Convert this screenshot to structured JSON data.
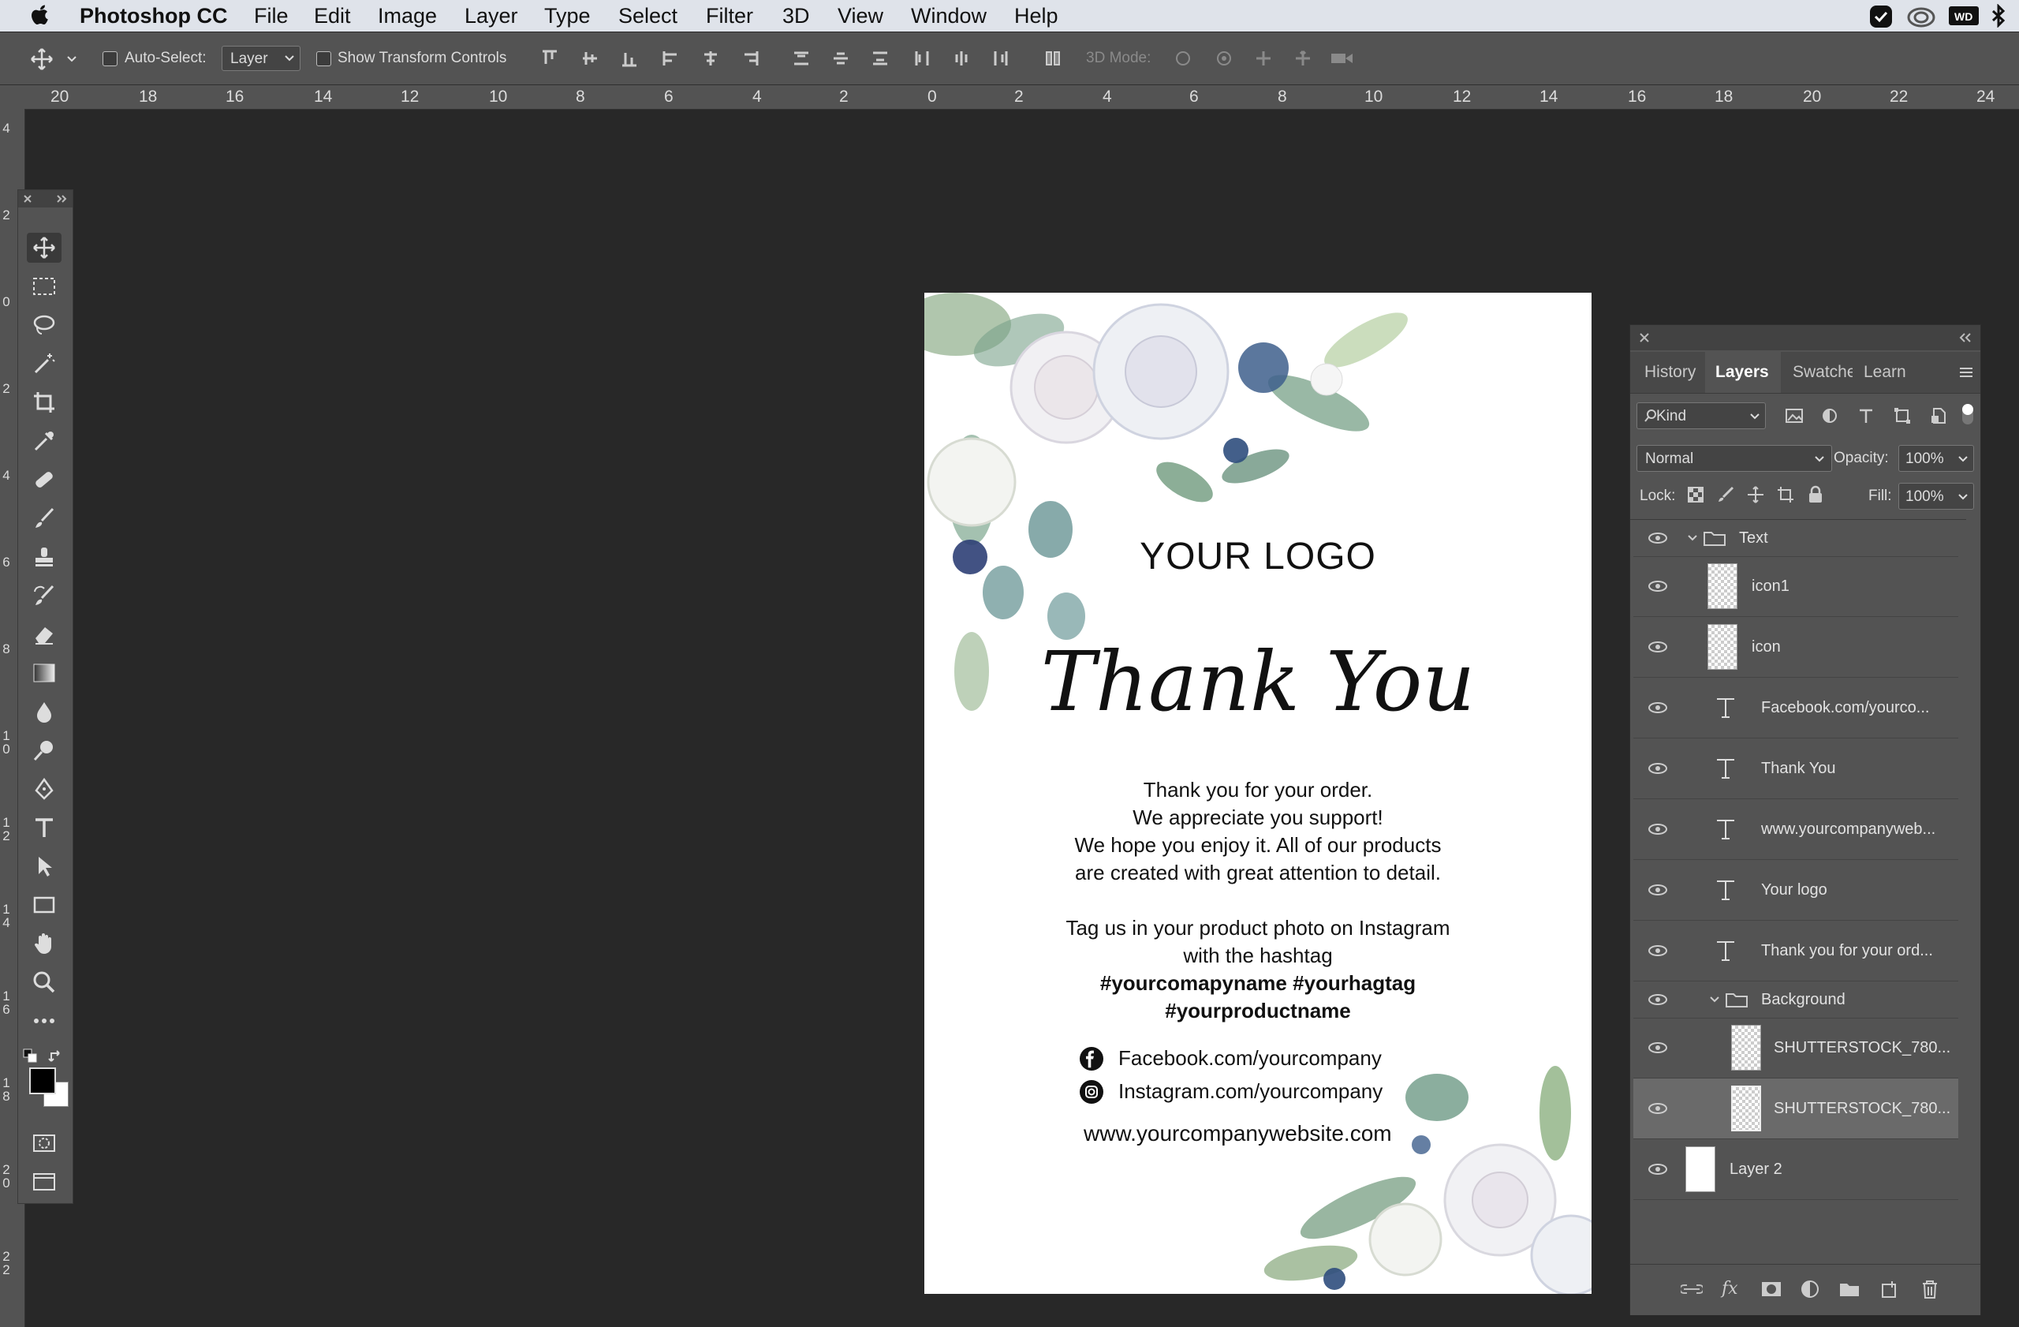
{
  "menubar": {
    "app": "Photoshop CC",
    "items": [
      "File",
      "Edit",
      "Image",
      "Layer",
      "Type",
      "Select",
      "Filter",
      "3D",
      "View",
      "Window",
      "Help"
    ]
  },
  "options": {
    "auto_select_label": "Auto-Select:",
    "auto_select_value": "Layer",
    "transform_label": "Show Transform Controls",
    "mode3d_label": "3D Mode:"
  },
  "ruler": {
    "h": [
      "20",
      "18",
      "16",
      "14",
      "12",
      "10",
      "8",
      "6",
      "4",
      "2",
      "0",
      "2",
      "4",
      "6",
      "8",
      "10",
      "12",
      "14",
      "16",
      "18",
      "20",
      "22",
      "24"
    ],
    "v": [
      "4",
      "2",
      "0",
      "2",
      "4",
      "6",
      "8",
      "1\n0",
      "1\n2",
      "1\n4",
      "1\n6",
      "1\n8",
      "2\n0",
      "2\n2"
    ]
  },
  "document": {
    "logo": "YOUR LOGO",
    "title": "Thank You",
    "body1": "Thank you for your order.",
    "body2": "We appreciate you support!",
    "body3": "We hope you enjoy it. All of our products",
    "body4": "are created with great attention to detail.",
    "tag1": "Tag us in your product photo on Instagram",
    "tag2": "with the hashtag",
    "hash1": "#yourcomapyname #yourhagtag",
    "hash2": "#yourproductname",
    "facebook": "Facebook.com/yourcompany",
    "instagram": "Instagram.com/yourcompany",
    "website": "www.yourcompanywebsite.com"
  },
  "panel": {
    "tabs": [
      "History",
      "Layers",
      "Swatche",
      "Learn"
    ],
    "filter_kind": "Kind",
    "blend_mode": "Normal",
    "opacity_label": "Opacity:",
    "opacity_value": "100%",
    "lock_label": "Lock:",
    "fill_label": "Fill:",
    "fill_value": "100%",
    "layers": [
      {
        "name": "Text",
        "kind": "group"
      },
      {
        "name": "icon1",
        "kind": "pixel"
      },
      {
        "name": "icon",
        "kind": "pixel"
      },
      {
        "name": "Facebook.com/yourco...",
        "kind": "text"
      },
      {
        "name": "Thank You",
        "kind": "text"
      },
      {
        "name": "www.yourcompanyweb...",
        "kind": "text"
      },
      {
        "name": "Your logo",
        "kind": "text"
      },
      {
        "name": "Thank you for your ord...",
        "kind": "text"
      },
      {
        "name": "Background",
        "kind": "group"
      },
      {
        "name": "SHUTTERSTOCK_780...",
        "kind": "pixel"
      },
      {
        "name": "SHUTTERSTOCK_780...",
        "kind": "pixel",
        "selected": true
      },
      {
        "name": "Layer 2",
        "kind": "fill"
      }
    ]
  },
  "colors": {
    "accent": "#3b6fd9",
    "panel_bg": "#535353",
    "canvas_bg": "#282828"
  }
}
